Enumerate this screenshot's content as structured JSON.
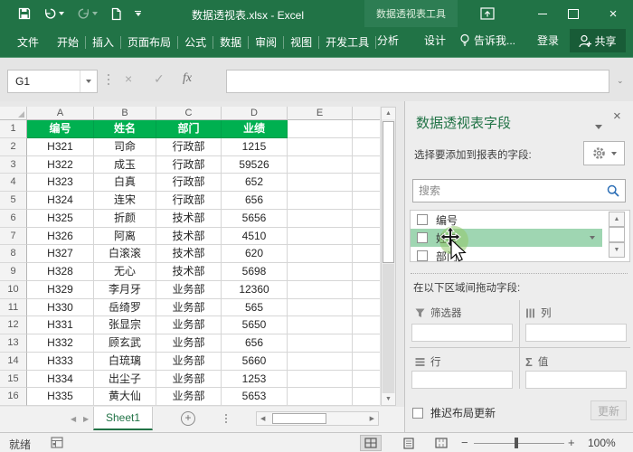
{
  "title_bar": {
    "document_title": "数据透视表.xlsx - Excel",
    "context_tool_label": "数据透视表工具"
  },
  "ribbon": {
    "file_tab": "文件",
    "tabs": [
      "开始",
      "插入",
      "页面布局",
      "公式",
      "数据",
      "审阅",
      "视图",
      "开发工具"
    ],
    "context_tabs": [
      "分析",
      "设计"
    ],
    "tell_me_label": "告诉我...",
    "sign_in_label": "登录",
    "share_label": "共享"
  },
  "formula_bar": {
    "name_box_value": "G1",
    "fx_label": "fx",
    "cancel_glyph": "×",
    "enter_glyph": "✓"
  },
  "sheet": {
    "columns": [
      "A",
      "B",
      "C",
      "D",
      "E"
    ],
    "rows": [
      {
        "n": "1",
        "header": true,
        "cells": [
          "编号",
          "姓名",
          "部门",
          "业绩"
        ]
      },
      {
        "n": "2",
        "cells": [
          "H321",
          "司命",
          "行政部",
          "1215"
        ]
      },
      {
        "n": "3",
        "cells": [
          "H322",
          "成玉",
          "行政部",
          "59526"
        ]
      },
      {
        "n": "4",
        "cells": [
          "H323",
          "白真",
          "行政部",
          "652"
        ]
      },
      {
        "n": "5",
        "cells": [
          "H324",
          "连宋",
          "行政部",
          "656"
        ]
      },
      {
        "n": "6",
        "cells": [
          "H325",
          "折颜",
          "技术部",
          "5656"
        ]
      },
      {
        "n": "7",
        "cells": [
          "H326",
          "阿离",
          "技术部",
          "4510"
        ]
      },
      {
        "n": "8",
        "cells": [
          "H327",
          "白滚滚",
          "技术部",
          "620"
        ]
      },
      {
        "n": "9",
        "cells": [
          "H328",
          "无心",
          "技术部",
          "5698"
        ]
      },
      {
        "n": "10",
        "cells": [
          "H329",
          "李月牙",
          "业务部",
          "12360"
        ]
      },
      {
        "n": "11",
        "cells": [
          "H330",
          "岳绮罗",
          "业务部",
          "565"
        ]
      },
      {
        "n": "12",
        "cells": [
          "H331",
          "张显宗",
          "业务部",
          "5650"
        ]
      },
      {
        "n": "13",
        "cells": [
          "H332",
          "顾玄武",
          "业务部",
          "656"
        ]
      },
      {
        "n": "14",
        "cells": [
          "H333",
          "白琉璃",
          "业务部",
          "5660"
        ]
      },
      {
        "n": "15",
        "cells": [
          "H334",
          "出尘子",
          "业务部",
          "1253"
        ]
      },
      {
        "n": "16",
        "cells": [
          "H335",
          "黄大仙",
          "业务部",
          "5653"
        ]
      }
    ],
    "active_tab": "Sheet1"
  },
  "status_bar": {
    "ready_label": "就绪",
    "zoom_level": "100%"
  },
  "fields_panel": {
    "title": "数据透视表字段",
    "subtitle": "选择要添加到报表的字段:",
    "search_placeholder": "搜索",
    "fields": [
      {
        "label": "编号",
        "checked": false,
        "highlighted": false
      },
      {
        "label": "姓名",
        "checked": false,
        "highlighted": true
      },
      {
        "label": "部门",
        "checked": false,
        "highlighted": false
      }
    ],
    "drag_hint": "在以下区域间拖动字段:",
    "areas": [
      {
        "name": "filters",
        "label": "筛选器"
      },
      {
        "name": "columns",
        "label": "列"
      },
      {
        "name": "rows",
        "label": "行"
      },
      {
        "name": "values",
        "label": "值"
      }
    ],
    "values_icon_glyph": "Σ",
    "defer_update_label": "推迟布局更新",
    "update_button_label": "更新"
  },
  "colors": {
    "excel_green": "#217346",
    "context_block_green": "#2d7d53",
    "share_button_green": "#185c37",
    "table_header_fill": "#00B050",
    "field_highlight": "#9fd6b2"
  }
}
